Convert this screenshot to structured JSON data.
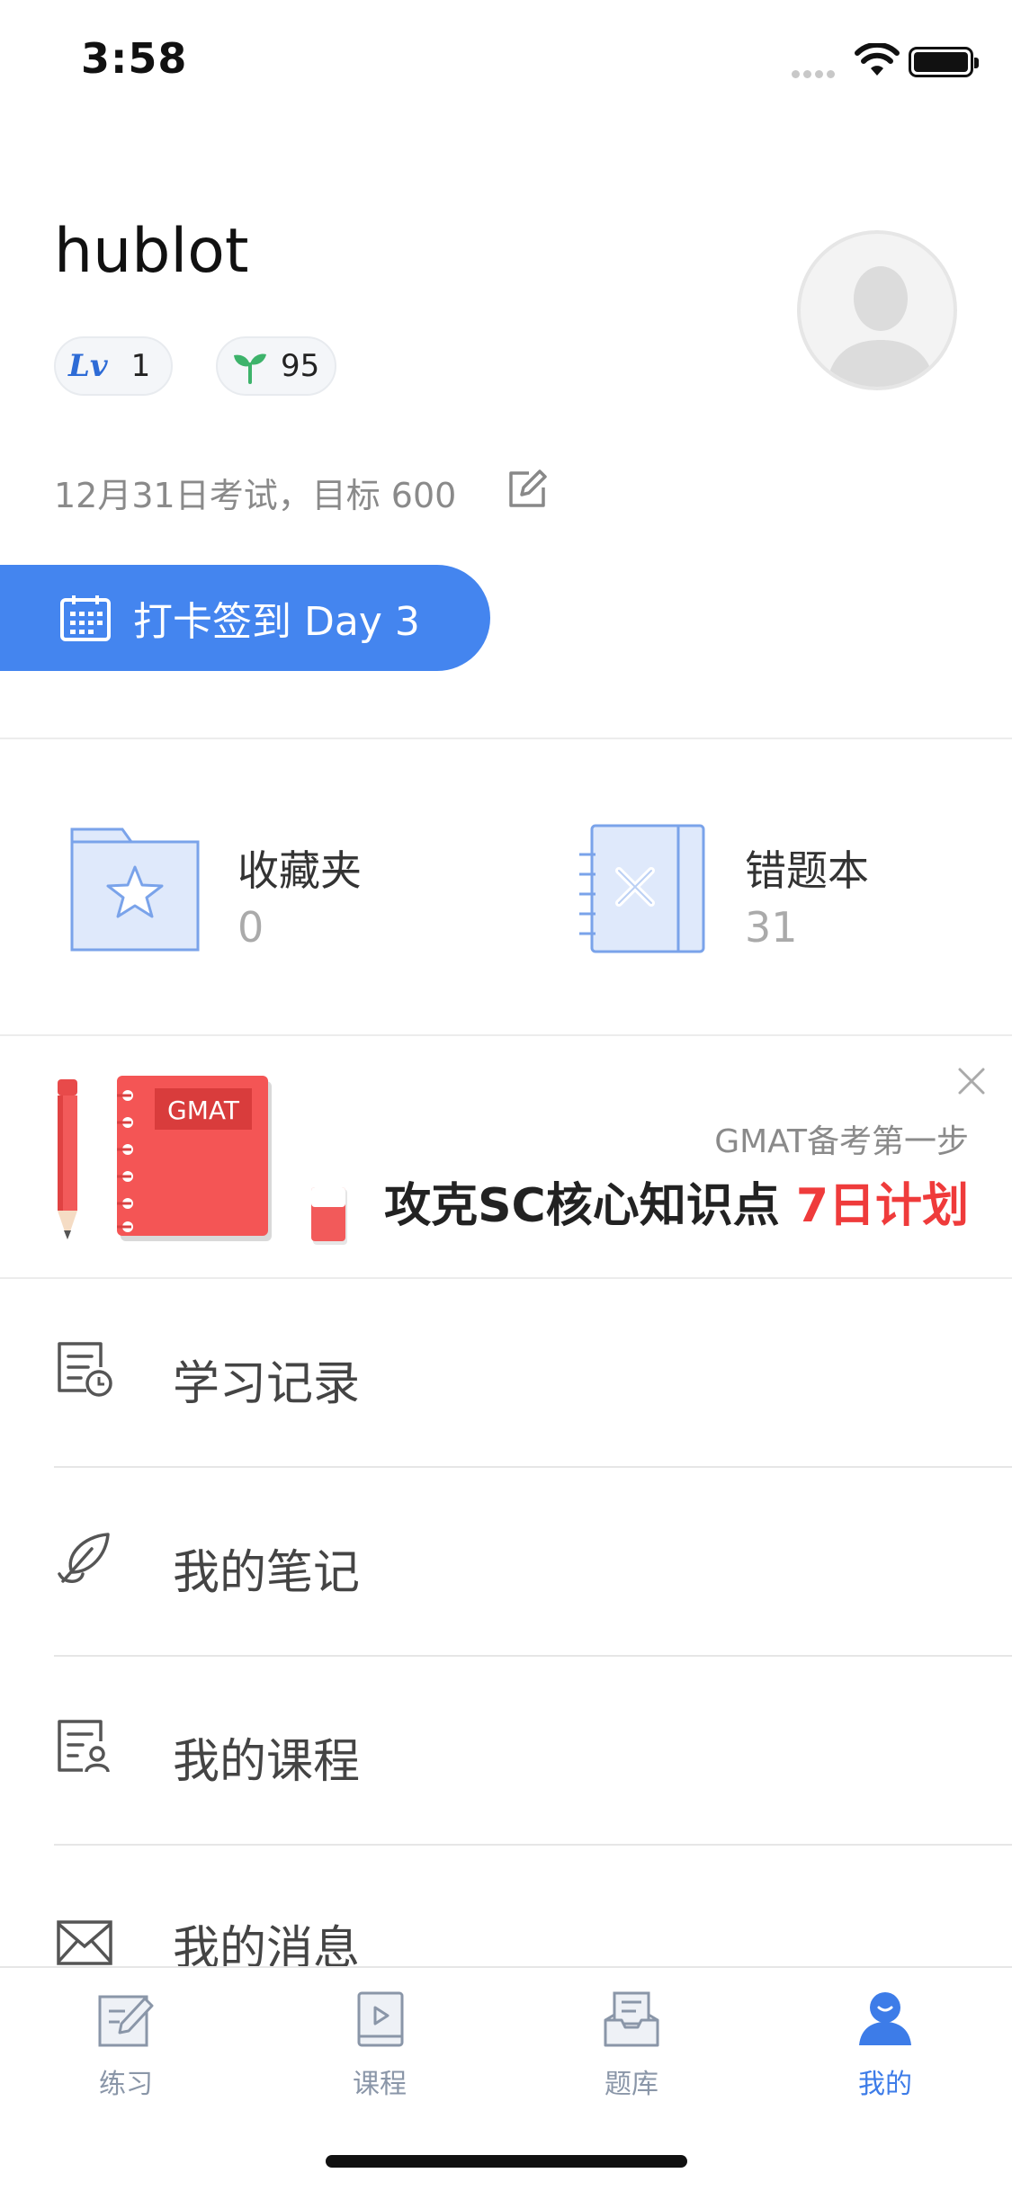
{
  "status_bar": {
    "time": "3:58"
  },
  "profile": {
    "username": "hublot",
    "level_prefix": "Lv",
    "level": "1",
    "points": "95",
    "goal": "12月31日考试，目标 600"
  },
  "checkin": {
    "label": "打卡签到 Day 3"
  },
  "collections": [
    {
      "label": "收藏夹",
      "count": "0"
    },
    {
      "label": "错题本",
      "count": "31"
    }
  ],
  "banner": {
    "badge": "GMAT",
    "subtitle": "GMAT备考第一步",
    "title": "攻克SC核心知识点 ",
    "title_accent": "7日计划"
  },
  "menu": [
    {
      "label": "学习记录",
      "icon": "study-record-icon"
    },
    {
      "label": "我的笔记",
      "icon": "feather-pen-icon"
    },
    {
      "label": "我的课程",
      "icon": "course-icon"
    },
    {
      "label": "我的消息",
      "icon": "mail-icon"
    }
  ],
  "tabs": [
    {
      "label": "练习",
      "icon": "practice-icon"
    },
    {
      "label": "课程",
      "icon": "course-book-icon"
    },
    {
      "label": "题库",
      "icon": "question-bank-icon"
    },
    {
      "label": "我的",
      "icon": "profile-icon",
      "active": true
    }
  ],
  "colors": {
    "accent": "#4485EF",
    "banner_accent": "#EF3B3B",
    "tab_inactive": "#8A96A8",
    "tab_active": "#3D7CE8"
  }
}
